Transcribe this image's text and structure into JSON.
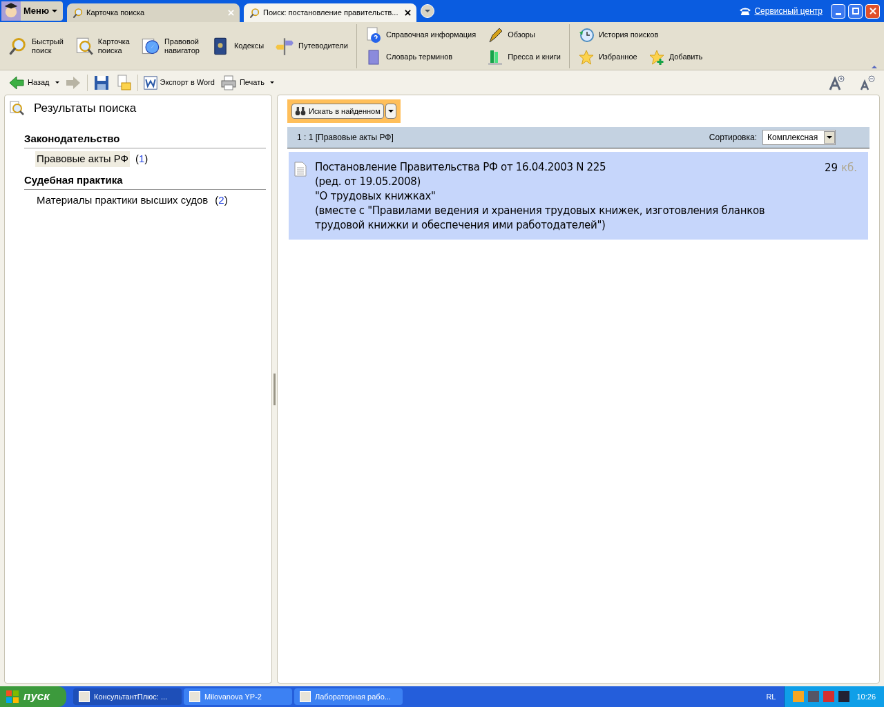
{
  "menu_button": "Меню",
  "tabs": [
    {
      "label": "Карточка поиска",
      "selected": false
    },
    {
      "label": "Поиск: постановление правительств...",
      "selected": true
    }
  ],
  "service_link": "Сервисный центр",
  "ribbon": {
    "main": [
      {
        "kind": "quick-search",
        "label": "Быстрый\nпоиск"
      },
      {
        "kind": "card-search",
        "label": "Карточка\nпоиска"
      },
      {
        "kind": "navigator",
        "label": "Правовой\nнавигатор"
      },
      {
        "kind": "codes",
        "label": "Кодексы"
      },
      {
        "kind": "guides",
        "label": "Путеводители"
      }
    ],
    "info": [
      {
        "kind": "help",
        "label": "Справочная информация"
      },
      {
        "kind": "pen",
        "label": "Обзоры"
      },
      {
        "kind": "dictionary",
        "label": "Словарь терминов"
      },
      {
        "kind": "books",
        "label": "Пресса и книги"
      }
    ],
    "history": [
      {
        "kind": "history",
        "label": "История поисков"
      },
      {
        "kind": "star",
        "label": "Избранное"
      },
      {
        "kind": "star-add",
        "label": "Добавить"
      }
    ]
  },
  "toolbar": {
    "back": "Назад",
    "export": "Экспорт в Word",
    "print": "Печать"
  },
  "left_panel": {
    "title": "Результаты поиска",
    "sections": [
      {
        "heading": "Законодательство",
        "items": [
          {
            "label": "Правовые акты РФ",
            "count": "(1)",
            "selected": true
          }
        ]
      },
      {
        "heading": "Судебная практика",
        "items": [
          {
            "label": "Материалы практики высших судов",
            "count": "(2)",
            "selected": false
          }
        ]
      }
    ]
  },
  "right_panel": {
    "search_in_found": "Искать в найденном",
    "header": "1 : 1 [Правовые акты РФ]",
    "sort_label": "Сортировка:",
    "sort_value": "Комплексная",
    "results": [
      {
        "lines": [
          "Постановление Правительства РФ от 16.04.2003 N 225",
          "(ред. от 19.05.2008)",
          "\"О трудовых книжках\"",
          "(вместе с \"Правилами ведения и хранения трудовых книжек, изготовления бланков",
          "трудовой книжки и обеспечения ими работодателей\")"
        ],
        "size": "29",
        "unit": "кб.",
        "selected": true
      }
    ]
  },
  "taskbar": {
    "start": "пуск",
    "tasks": [
      {
        "label": "КонсультантПлюс: ...",
        "selected": true
      },
      {
        "label": "Milovanova YP-2",
        "selected": false
      },
      {
        "label": "Лабораторная рабо...",
        "selected": false
      }
    ],
    "language": "RL",
    "clock": "10:26"
  }
}
